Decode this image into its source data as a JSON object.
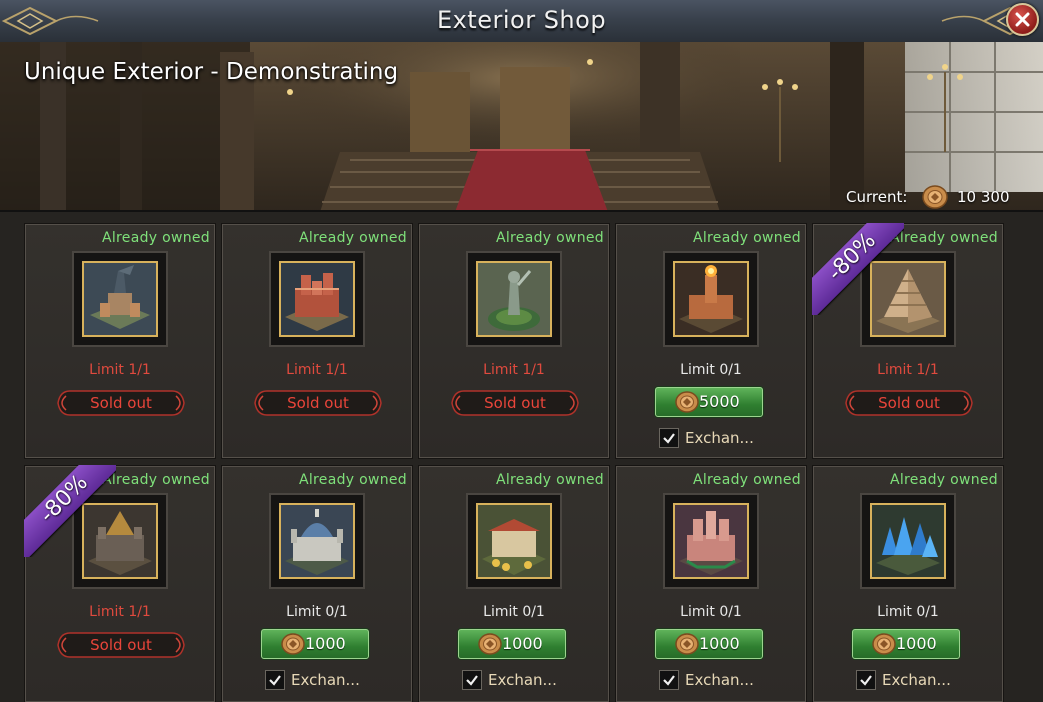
{
  "window": {
    "title": "Exterior Shop"
  },
  "banner": {
    "title": "Unique Exterior - Demonstrating",
    "currency_label": "Current:",
    "currency_amount": "10 300",
    "currency_icon": "coin-icon"
  },
  "colors": {
    "owned_green": "#7fe07a",
    "limit_red": "#e04a3e",
    "buy_green": "#2f7f30",
    "discount_purple": "#6f36ad"
  },
  "items": [
    {
      "owned": "Already owned",
      "limit": "Limit 1/1",
      "state": "sold",
      "sold_label": "Sold out",
      "discount": ""
    },
    {
      "owned": "Already owned",
      "limit": "Limit 1/1",
      "state": "sold",
      "sold_label": "Sold out",
      "discount": ""
    },
    {
      "owned": "Already owned",
      "limit": "Limit 1/1",
      "state": "sold",
      "sold_label": "Sold out",
      "discount": ""
    },
    {
      "owned": "Already owned",
      "limit": "Limit 0/1",
      "state": "buy",
      "price": "5000",
      "exchange_label": "Exchan...",
      "exchange_checked": true,
      "discount": ""
    },
    {
      "owned": "Already owned",
      "limit": "Limit 1/1",
      "state": "sold",
      "sold_label": "Sold out",
      "discount": "-80%"
    },
    {
      "owned": "Already owned",
      "limit": "Limit 1/1",
      "state": "sold",
      "sold_label": "Sold out",
      "discount": "-80%"
    },
    {
      "owned": "Already owned",
      "limit": "Limit 0/1",
      "state": "buy",
      "price": "1000",
      "exchange_label": "Exchan...",
      "exchange_checked": true,
      "discount": ""
    },
    {
      "owned": "Already owned",
      "limit": "Limit 0/1",
      "state": "buy",
      "price": "1000",
      "exchange_label": "Exchan...",
      "exchange_checked": true,
      "discount": ""
    },
    {
      "owned": "Already owned",
      "limit": "Limit 0/1",
      "state": "buy",
      "price": "1000",
      "exchange_label": "Exchan...",
      "exchange_checked": true,
      "discount": ""
    },
    {
      "owned": "Already owned",
      "limit": "Limit 0/1",
      "state": "buy",
      "price": "1000",
      "exchange_label": "Exchan...",
      "exchange_checked": true,
      "discount": ""
    }
  ]
}
